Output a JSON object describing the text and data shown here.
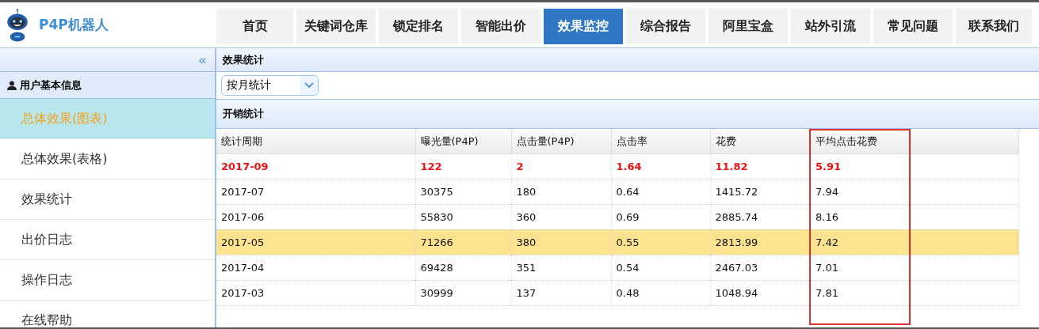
{
  "brand": {
    "title": "P4P机器人"
  },
  "nav": [
    {
      "label": "首页",
      "selected": false
    },
    {
      "label": "关键词仓库",
      "selected": false
    },
    {
      "label": "锁定排名",
      "selected": false
    },
    {
      "label": "智能出价",
      "selected": false
    },
    {
      "label": "效果监控",
      "selected": true
    },
    {
      "label": "综合报告",
      "selected": false
    },
    {
      "label": "阿里宝盒",
      "selected": false
    },
    {
      "label": "站外引流",
      "selected": false
    },
    {
      "label": "常见问题",
      "selected": false
    },
    {
      "label": "联系我们",
      "selected": false
    }
  ],
  "sidebar": {
    "collapse": "«",
    "header": "用户基本信息",
    "items": [
      {
        "label": "总体效果(图表)",
        "selected": true
      },
      {
        "label": "总体效果(表格)",
        "selected": false
      },
      {
        "label": "效果统计",
        "selected": false
      },
      {
        "label": "出价日志",
        "selected": false
      },
      {
        "label": "操作日志",
        "selected": false
      },
      {
        "label": "在线帮助",
        "selected": false
      }
    ]
  },
  "main": {
    "title": "效果统计",
    "period_select": {
      "value": "按月统计"
    },
    "section": "开销统计",
    "table": {
      "columns": [
        {
          "label": "统计周期",
          "highlighted": false
        },
        {
          "label": "曝光量(P4P)",
          "highlighted": false
        },
        {
          "label": "点击量(P4P)",
          "highlighted": false
        },
        {
          "label": "点击率",
          "highlighted": false
        },
        {
          "label": "花费",
          "highlighted": false
        },
        {
          "label": "平均点击花费",
          "highlighted": true
        }
      ],
      "rows": [
        {
          "cells": [
            "2017-09",
            "122",
            "2",
            "1.64",
            "11.82",
            "5.91"
          ],
          "emphasized": true,
          "highlighted": false
        },
        {
          "cells": [
            "2017-07",
            "30375",
            "180",
            "0.64",
            "1415.72",
            "7.94"
          ],
          "emphasized": false,
          "highlighted": false
        },
        {
          "cells": [
            "2017-06",
            "55830",
            "360",
            "0.69",
            "2885.74",
            "8.16"
          ],
          "emphasized": false,
          "highlighted": false
        },
        {
          "cells": [
            "2017-05",
            "71266",
            "380",
            "0.55",
            "2813.99",
            "7.42"
          ],
          "emphasized": false,
          "highlighted": true
        },
        {
          "cells": [
            "2017-04",
            "69428",
            "351",
            "0.54",
            "2467.03",
            "7.01"
          ],
          "emphasized": false,
          "highlighted": false
        },
        {
          "cells": [
            "2017-03",
            "30999",
            "137",
            "0.48",
            "1048.94",
            "7.81"
          ],
          "emphasized": false,
          "highlighted": false
        }
      ]
    }
  }
}
